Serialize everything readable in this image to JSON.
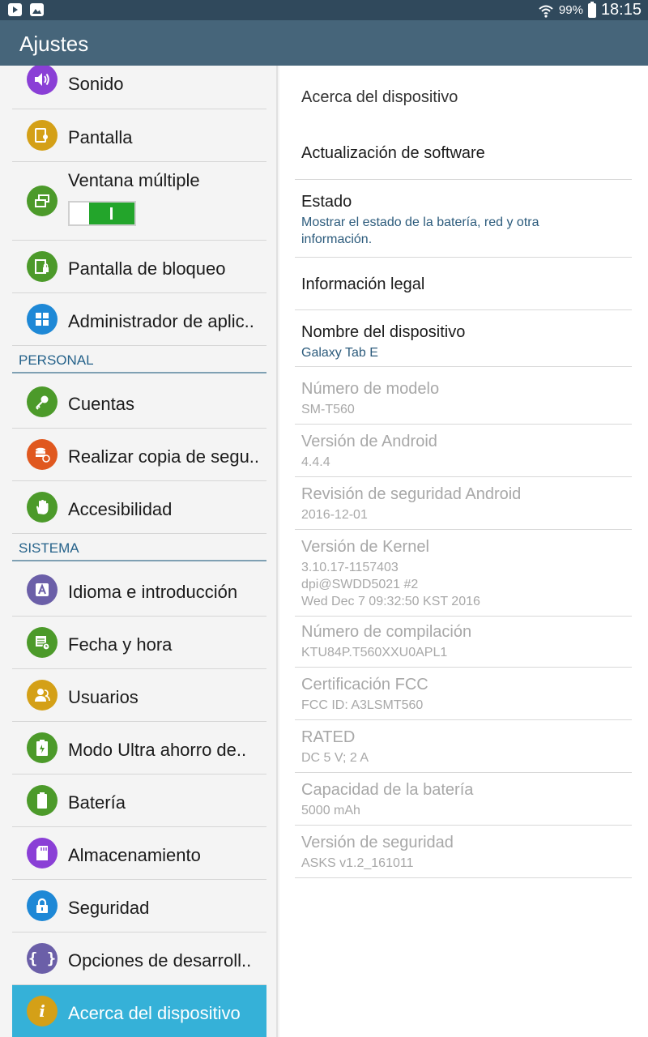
{
  "status_bar": {
    "battery_percent": "99%",
    "time": "18:15",
    "icons": [
      "youtube-icon",
      "image-icon",
      "wifi-icon",
      "battery-icon"
    ]
  },
  "action_bar": {
    "title": "Ajustes"
  },
  "left_menu": {
    "items_top": [
      {
        "label": "Sonido",
        "icon": "sound-icon",
        "color": "#8a3fd6"
      },
      {
        "label": "Pantalla",
        "icon": "display-icon",
        "color": "#d4a017"
      },
      {
        "label": "Ventana múltiple",
        "icon": "multi-window-icon",
        "color": "#4c9a2a",
        "toggle_on": true
      },
      {
        "label": "Pantalla de bloqueo",
        "icon": "lock-screen-icon",
        "color": "#4c9a2a"
      },
      {
        "label": "Administrador de aplic..",
        "icon": "apps-icon",
        "color": "#1e88d6"
      }
    ],
    "section_personal": "PERSONAL",
    "items_personal": [
      {
        "label": "Cuentas",
        "icon": "key-icon",
        "color": "#4c9a2a"
      },
      {
        "label": "Realizar copia de segu..",
        "icon": "backup-icon",
        "color": "#e0581f"
      },
      {
        "label": "Accesibilidad",
        "icon": "hand-icon",
        "color": "#4c9a2a"
      }
    ],
    "section_sistema": "SISTEMA",
    "items_sistema": [
      {
        "label": "Idioma e introducción",
        "icon": "language-icon",
        "color": "#6b5fa8"
      },
      {
        "label": "Fecha y hora",
        "icon": "calendar-icon",
        "color": "#4c9a2a"
      },
      {
        "label": "Usuarios",
        "icon": "users-icon",
        "color": "#d4a017"
      },
      {
        "label": "Modo Ultra ahorro de..",
        "icon": "ultra-power-icon",
        "color": "#4c9a2a"
      },
      {
        "label": "Batería",
        "icon": "battery-icon",
        "color": "#4c9a2a"
      },
      {
        "label": "Almacenamiento",
        "icon": "storage-icon",
        "color": "#8a3fd6"
      },
      {
        "label": "Seguridad",
        "icon": "lock-icon",
        "color": "#1e88d6"
      },
      {
        "label": "Opciones de desarroll..",
        "icon": "developer-icon",
        "color": "#6b5fa8"
      },
      {
        "label": "Acerca del dispositivo",
        "icon": "info-icon",
        "color": "#d4a017",
        "selected": true
      }
    ]
  },
  "right_pane": {
    "header": "Acerca del dispositivo",
    "items": [
      {
        "title": "Actualización de software",
        "enabled": true
      },
      {
        "title": "Estado",
        "subtitle": "Mostrar el estado de la batería, red y otra información.",
        "enabled": true
      },
      {
        "title": "Información legal",
        "enabled": true
      },
      {
        "title": "Nombre del dispositivo",
        "subtitle": "Galaxy Tab E",
        "enabled": true
      },
      {
        "title": "Número de modelo",
        "subtitle": "SM-T560",
        "enabled": false
      },
      {
        "title": "Versión de Android",
        "subtitle": "4.4.4",
        "enabled": false
      },
      {
        "title": "Revisión de seguridad Android",
        "subtitle": "2016-12-01",
        "enabled": false
      },
      {
        "title": "Versión de Kernel",
        "subtitle_lines": [
          "3.10.17-1157403",
          "dpi@SWDD5021 #2",
          "Wed Dec 7 09:32:50 KST 2016"
        ],
        "enabled": false
      },
      {
        "title": "Número de compilación",
        "subtitle": "KTU84P.T560XXU0APL1",
        "enabled": false
      },
      {
        "title": "Certificación FCC",
        "subtitle": "FCC ID: A3LSMT560",
        "enabled": false
      },
      {
        "title": "RATED",
        "subtitle": "DC 5 V; 2 A",
        "enabled": false
      },
      {
        "title": "Capacidad de la batería",
        "subtitle": "5000 mAh",
        "enabled": false
      },
      {
        "title": "Versión de seguridad",
        "subtitle": "ASKS v1.2_161011",
        "enabled": false
      }
    ]
  }
}
